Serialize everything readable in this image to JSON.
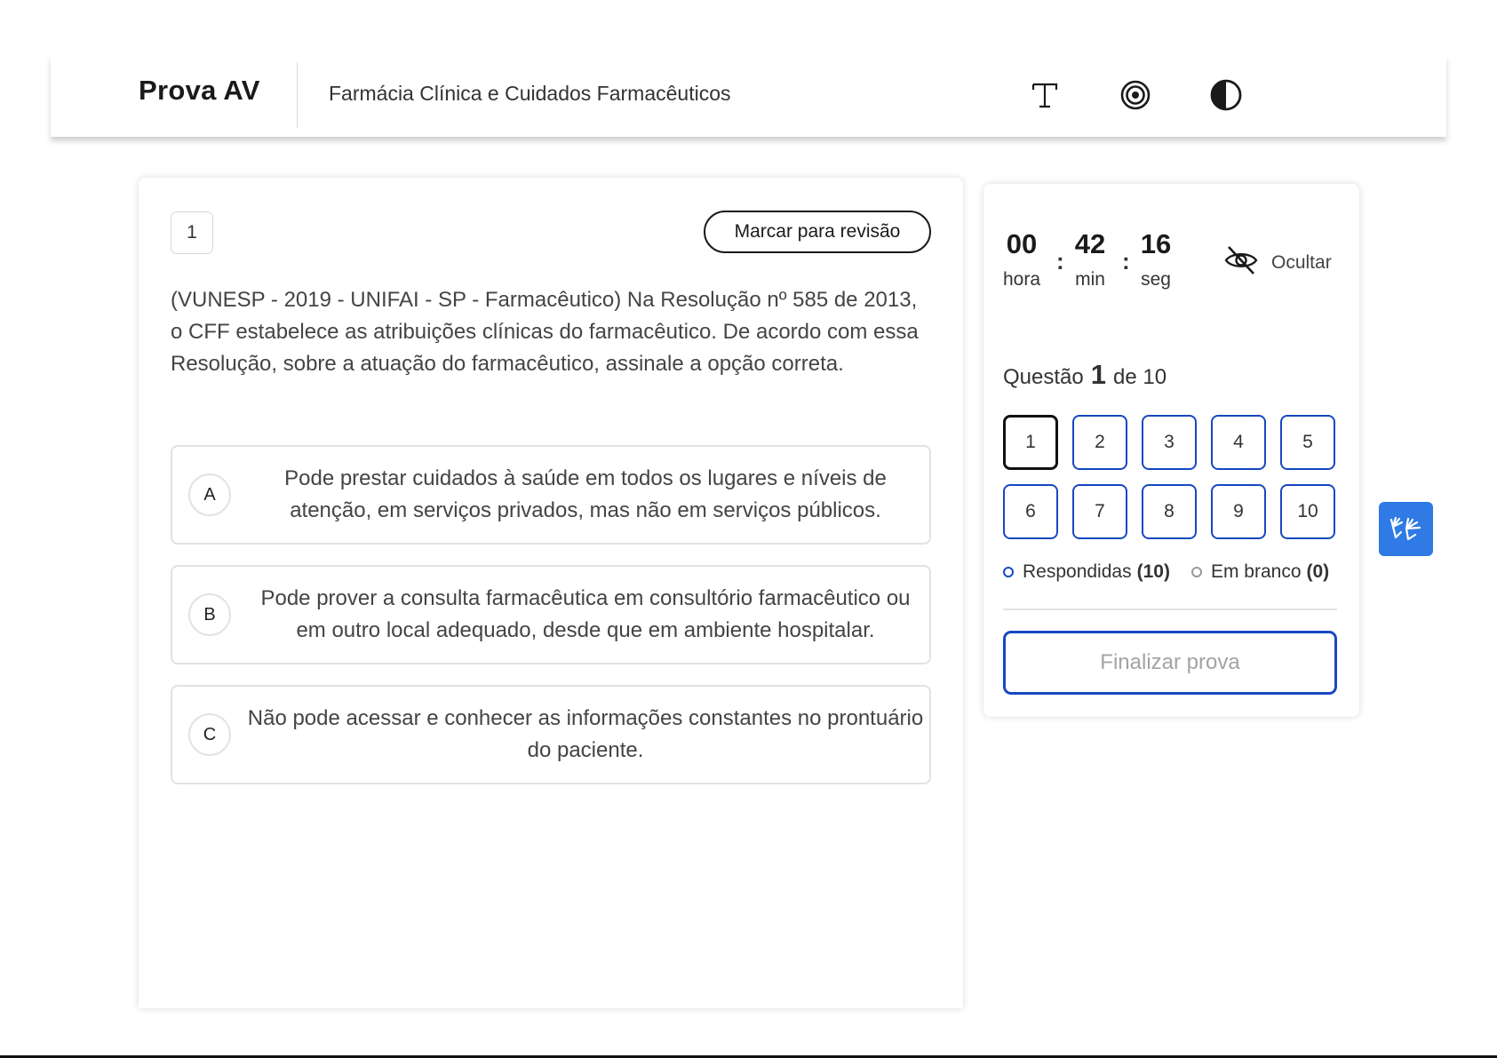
{
  "header": {
    "logo": "Prova AV",
    "course_title": "Farmácia Clínica e Cuidados Farmacêuticos",
    "icons": [
      "font-size-icon",
      "focus-icon",
      "contrast-icon"
    ]
  },
  "question": {
    "number": "1",
    "review_label": "Marcar para revisão",
    "statement": "(VUNESP - 2019 - UNIFAI - SP - Farmacêutico) Na Resolução nº 585 de 2013, o CFF estabelece as atribuições clínicas do farmacêutico. De acordo com essa Resolução, sobre a atuação do farmacêutico, assinale a opção correta.",
    "options": [
      {
        "letter": "A",
        "text": "Pode prestar cuidados à saúde em todos os lugares e níveis de atenção, em serviços privados, mas não em serviços públicos."
      },
      {
        "letter": "B",
        "text": "Pode prover a consulta farmacêutica em consultório farmacêutico ou em outro local adequado, desde que em ambiente hospitalar."
      },
      {
        "letter": "C",
        "text": "Não pode acessar e conhecer as informações constantes no prontuário do paciente."
      }
    ]
  },
  "timer": {
    "hours": "00",
    "minutes": "42",
    "seconds": "16",
    "hours_label": "hora",
    "minutes_label": "min",
    "seconds_label": "seg",
    "separator": ":",
    "hide_label": "Ocultar"
  },
  "progress": {
    "prefix": "Questão",
    "current": "1",
    "suffix": "de 10",
    "questions": [
      "1",
      "2",
      "3",
      "4",
      "5",
      "6",
      "7",
      "8",
      "9",
      "10"
    ],
    "current_index": 0
  },
  "legend": {
    "answered_label": "Respondidas",
    "answered_count": "(10)",
    "blank_label": "Em branco",
    "blank_count": "(0)"
  },
  "finish_label": "Finalizar prova",
  "colors": {
    "accent": "#1748c2",
    "libras": "#2f7ae5"
  }
}
